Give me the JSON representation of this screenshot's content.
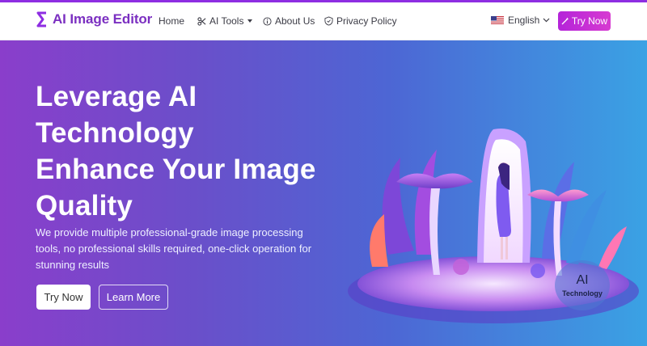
{
  "nav": {
    "brand": "AI Image Editor",
    "items": [
      {
        "label": "Home"
      },
      {
        "label": "AI Tools"
      },
      {
        "label": "About Us"
      },
      {
        "label": "Privacy Policy"
      }
    ],
    "language": "English",
    "cta": "Try Now"
  },
  "hero": {
    "title_lines": [
      "Leverage AI",
      "Technology",
      "Enhance Your Image",
      "Quality"
    ],
    "description": "We provide multiple professional-grade image processing tools, no professional skills required, one-click operation for stunning results",
    "primary_button": "Try Now",
    "secondary_button": "Learn More",
    "badge": {
      "line1": "AI",
      "line2": "Technology"
    }
  },
  "colors": {
    "brand": "#7b2fc1",
    "cta_gradient_start": "#b424d9",
    "hero_gradient_start": "#8a3ecb",
    "hero_gradient_end": "#3aa2e4"
  }
}
